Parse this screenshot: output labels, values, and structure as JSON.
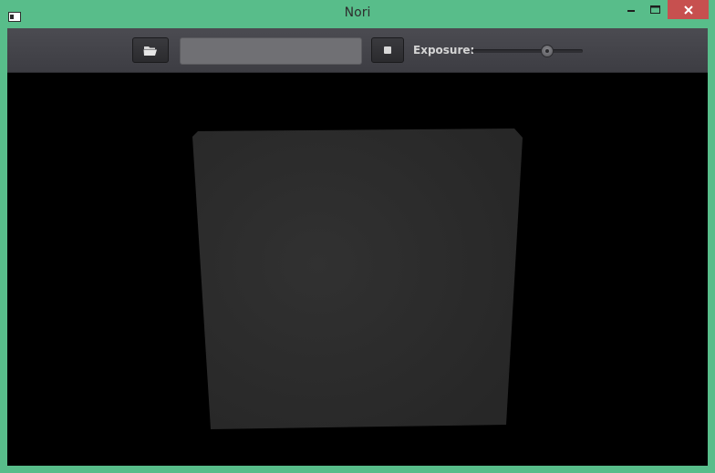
{
  "window": {
    "title": "Nori",
    "accent_color": "#58bd8a",
    "close_color": "#c7504f"
  },
  "toolbar": {
    "open_button_icon": "folder-open-icon",
    "filename_value": "",
    "stop_button_icon": "stop-icon",
    "exposure_label": "Exposure:",
    "exposure_level": 0.68
  },
  "render": {
    "background_color": "#000000",
    "surface_color": "#2b2b2b"
  }
}
